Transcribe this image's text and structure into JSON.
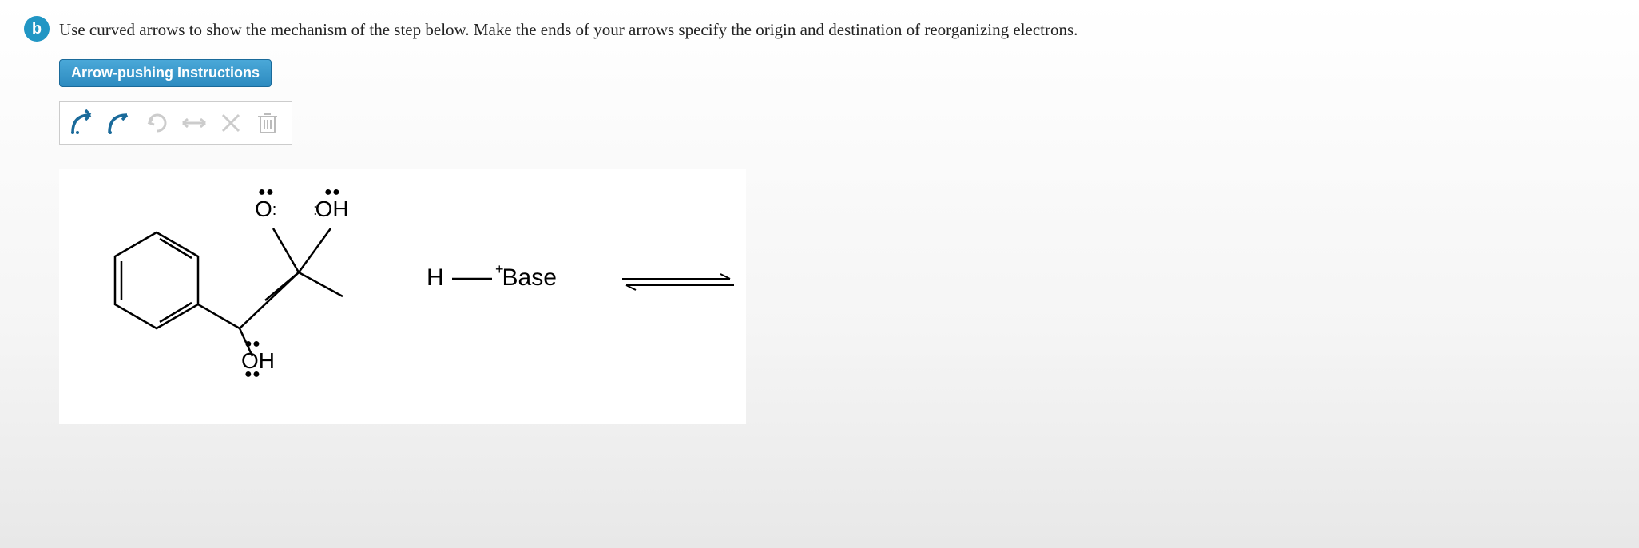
{
  "bullet_label": "b",
  "prompt": "Use curved arrows to show the mechanism of the step below. Make the ends of your arrows specify the origin and destination of reorganizing electrons.",
  "instructions_button": "Arrow-pushing Instructions",
  "toolbar": {
    "tools": [
      {
        "name": "double-arrow-tool",
        "active": true
      },
      {
        "name": "single-arrow-tool",
        "active": true
      },
      {
        "name": "redo-tool",
        "active": false
      },
      {
        "name": "undo-tool",
        "active": false
      },
      {
        "name": "delete-tool",
        "active": false
      },
      {
        "name": "trash-tool",
        "active": false
      }
    ]
  },
  "reaction": {
    "part2_h": "H",
    "part2_base": "Base",
    "part2_charge": "+",
    "atom_o_left": "O",
    "atom_oh_right": "OH",
    "atom_oh_bottom": "OH"
  }
}
